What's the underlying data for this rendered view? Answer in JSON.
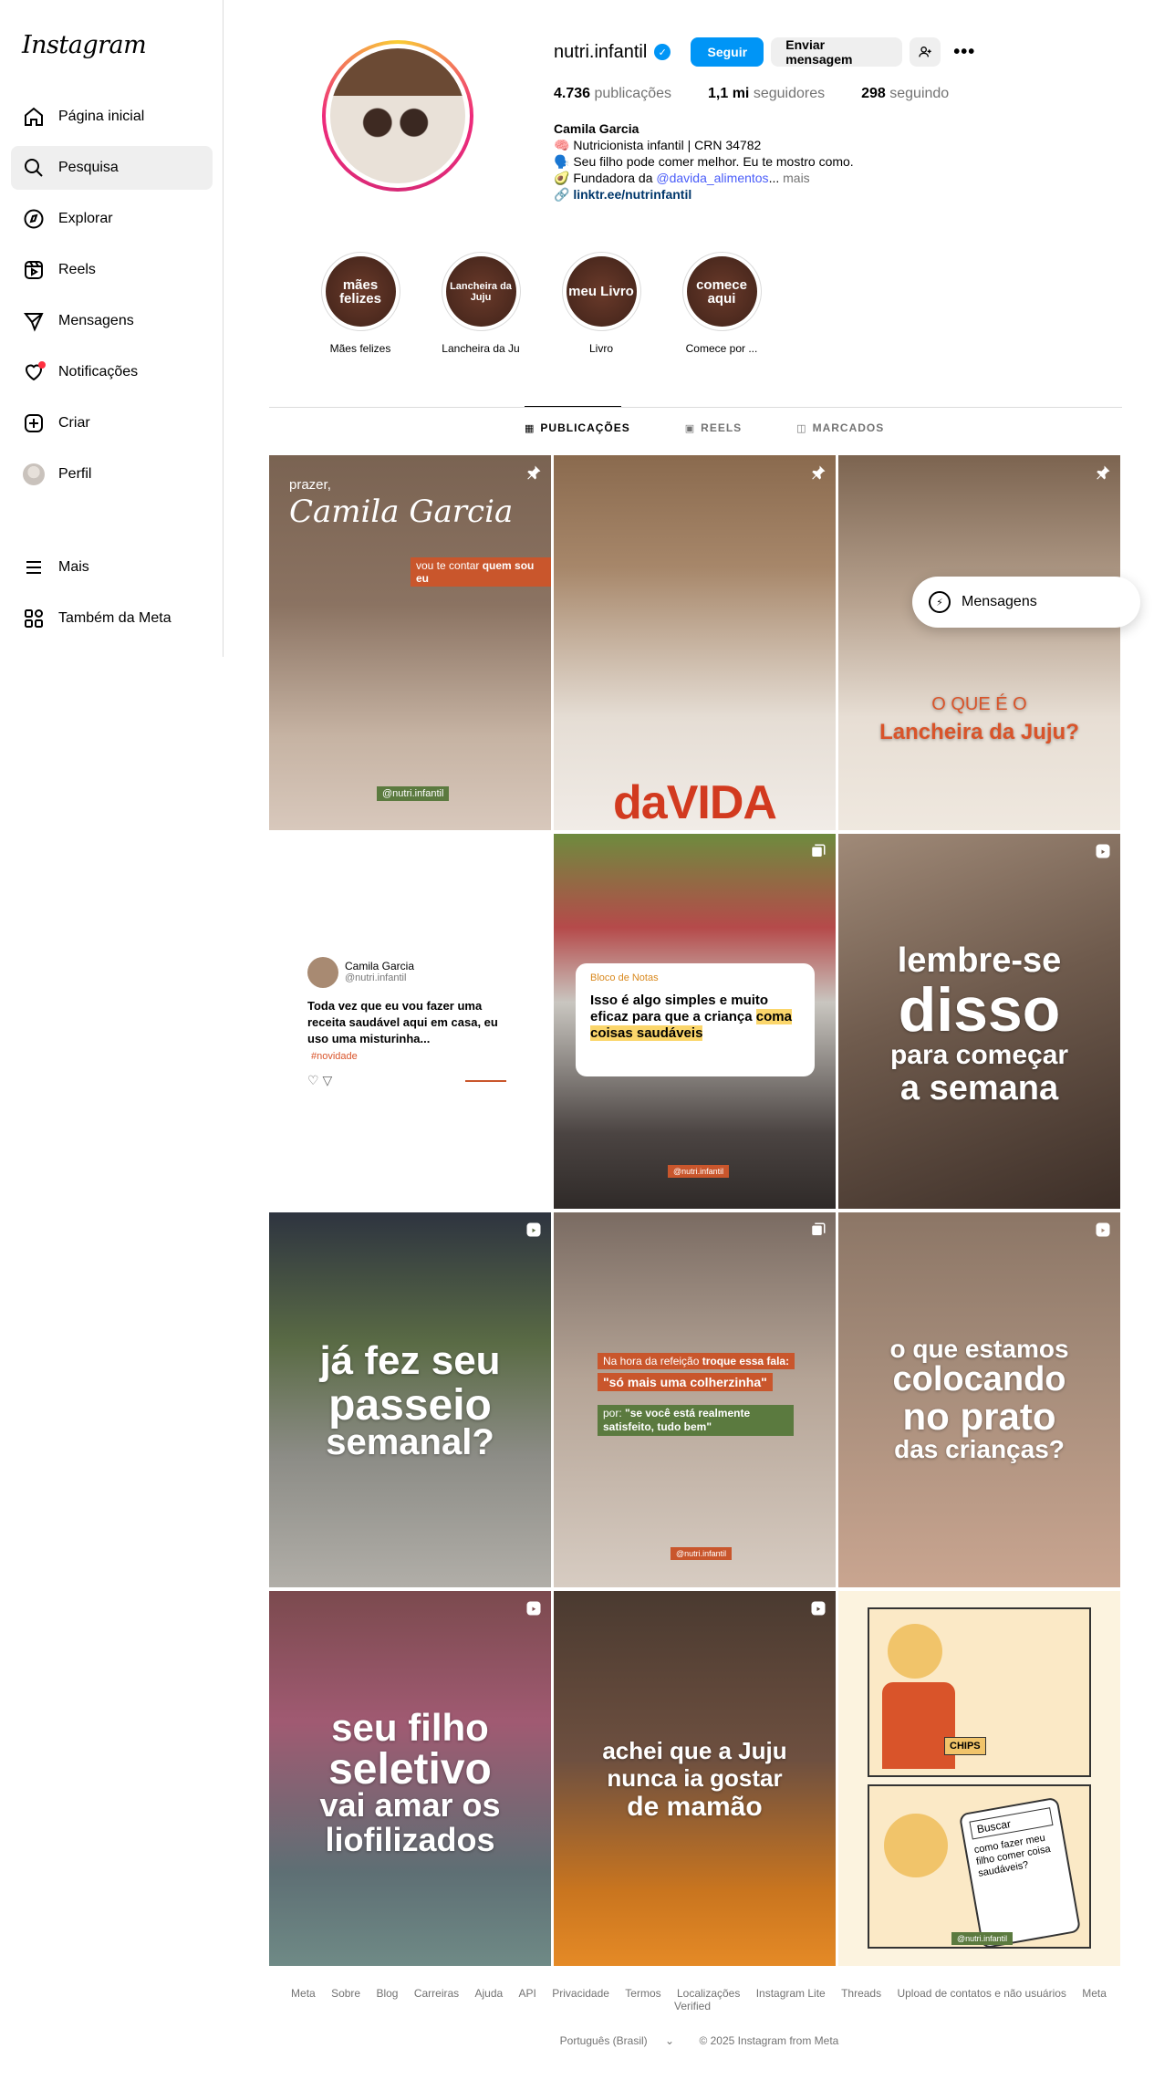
{
  "app": {
    "logo": "Instagram"
  },
  "sidebar": {
    "items": [
      {
        "label": "Página inicial",
        "icon": "home-icon"
      },
      {
        "label": "Pesquisa",
        "icon": "search-icon"
      },
      {
        "label": "Explorar",
        "icon": "compass-icon"
      },
      {
        "label": "Reels",
        "icon": "reels-icon"
      },
      {
        "label": "Mensagens",
        "icon": "send-icon"
      },
      {
        "label": "Notificações",
        "icon": "heart-icon"
      },
      {
        "label": "Criar",
        "icon": "plus-square-icon"
      },
      {
        "label": "Perfil",
        "icon": "avatar"
      }
    ],
    "bottom": [
      {
        "label": "Mais",
        "icon": "menu-icon"
      },
      {
        "label": "Também da Meta",
        "icon": "meta-apps-icon"
      }
    ]
  },
  "profile": {
    "username": "nutri.infantil",
    "follow_label": "Seguir",
    "message_label": "Enviar mensagem",
    "stats": {
      "posts_value": "4.736",
      "posts_label": "publicações",
      "followers_value": "1,1 mi",
      "followers_label": "seguidores",
      "following_value": "298",
      "following_label": "seguindo"
    },
    "bio": {
      "name": "Camila Garcia",
      "line1": "🧠 Nutricionista infantil | CRN 34782",
      "line2": "🗣️ Seu filho pode comer melhor. Eu te mostro como.",
      "line3_prefix": "🥑 Fundadora da ",
      "line3_mention": "@davida_alimentos",
      "line3_suffix": "...",
      "line3_more": " mais",
      "link_icon": "🔗",
      "link": "linktr.ee/nutrinfantil"
    }
  },
  "highlights": [
    {
      "cover": "mães felizes",
      "label": "Mães felizes"
    },
    {
      "cover": "Lancheira da Juju",
      "label": "Lancheira da Ju"
    },
    {
      "cover": "meu Livro",
      "label": "Livro"
    },
    {
      "cover": "comece aqui",
      "label": "Comece por ..."
    }
  ],
  "tabs": [
    {
      "label": "PUBLICAÇÕES",
      "icon": "grid-icon"
    },
    {
      "label": "REELS",
      "icon": "reels-icon"
    },
    {
      "label": "MARCADOS",
      "icon": "tagged-icon"
    }
  ],
  "posts": {
    "p1": {
      "small": "prazer,",
      "big": "Camila Garcia",
      "tag_a": "vou te contar ",
      "tag_b": "quem sou eu",
      "handle": "@nutri.infantil"
    },
    "p2": {
      "brand": "daVIDA"
    },
    "p3": {
      "l1": "O QUE É O",
      "l2": "Lancheira da Juju?"
    },
    "p4": {
      "name": "Camila Garcia",
      "handle": "@nutri.infantil",
      "text": "Toda vez que eu vou fazer uma receita saudável aqui em casa, eu uso uma misturinha...",
      "tag": "#novidade"
    },
    "p5": {
      "note_title": "Bloco de Notas",
      "l1": "Isso é algo simples e muito eficaz para que a criança ",
      "l2": "coma coisas saudáveis",
      "handle": "@nutri.infantil"
    },
    "p6": {
      "l1": "lembre-se",
      "l2": "disso",
      "l3": "para começar",
      "l4": "a semana"
    },
    "p7": {
      "l1": "já fez seu",
      "l2": "passeio",
      "l3": "semanal?"
    },
    "p8": {
      "a": "Na hora da refeição ",
      "b": "troque essa fala:",
      "q1": "\"só mais uma colherzinha\"",
      "c": "por: ",
      "q2": "\"se você está realmente satisfeito, tudo bem\"",
      "handle": "@nutri.infantil"
    },
    "p9": {
      "l1": "o que estamos",
      "l2": "colocando",
      "l3": "no prato",
      "l4": "das crianças?"
    },
    "p10": {
      "l1": "seu filho",
      "l2": "seletivo",
      "l3": "vai amar os",
      "l4": "liofilizados"
    },
    "p11": {
      "l1": "achei que a Juju",
      "l2": "nunca ia gostar",
      "l3": "de mamão"
    },
    "p12": {
      "chips": "CHIPS",
      "search": "Buscar",
      "query": "como fazer meu filho comer coisa saudáveis?",
      "handle": "@nutri.infantil"
    }
  },
  "floating": {
    "messages_label": "Mensagens"
  },
  "footer": {
    "links": [
      "Meta",
      "Sobre",
      "Blog",
      "Carreiras",
      "Ajuda",
      "API",
      "Privacidade",
      "Termos",
      "Localizações",
      "Instagram Lite",
      "Threads",
      "Upload de contatos e não usuários",
      "Meta Verified"
    ],
    "language": "Português (Brasil)",
    "copyright": "© 2025 Instagram from Meta"
  },
  "colors": {
    "accent": "#0095f6",
    "verified": "#0095f6",
    "notification_dot": "#ff3040"
  }
}
